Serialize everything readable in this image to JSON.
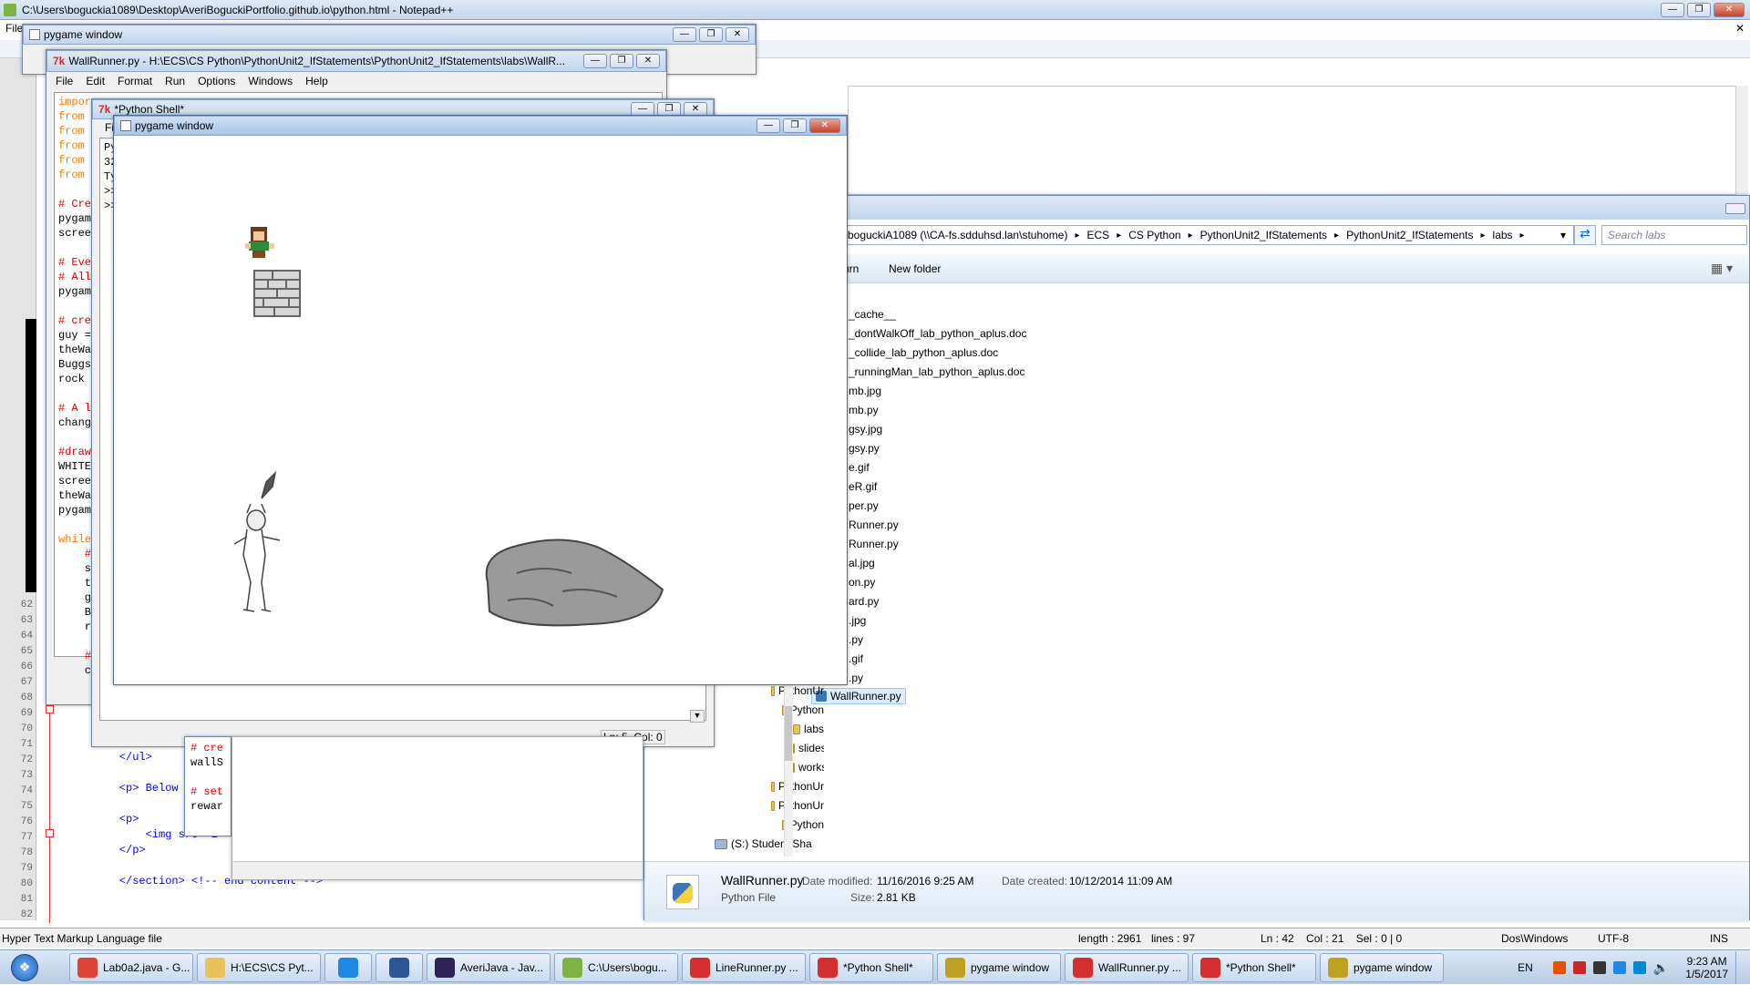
{
  "notepad": {
    "title": "C:\\Users\\boguckia1089\\Desktop\\AveriBoguckiPortfolio.github.io\\python.html - Notepad++",
    "menu_first": "File",
    "gutter_lines": [
      "62",
      "63",
      "64",
      "65",
      "66",
      "67",
      "68",
      "69",
      "70",
      "71",
      "72",
      "73",
      "74",
      "75",
      "76",
      "77",
      "78",
      "79",
      "80",
      "81",
      "82"
    ],
    "code_lines": [
      {
        "n": "72",
        "text": "        <li>"
      },
      {
        "n": "73",
        "text": "    </ul>"
      },
      {
        "n": "75",
        "text": "    <p> Below"
      },
      {
        "n": "77",
        "text": "    <p>"
      },
      {
        "n": "78",
        "text": "        <img src=\"i"
      },
      {
        "n": "79",
        "text": "    </p>"
      },
      {
        "n": "81",
        "text": "    </section> <!-- end content -->"
      }
    ],
    "status": {
      "file_type": "Hyper Text Markup Language file",
      "length": "length : 2961",
      "lines": "lines : 97",
      "position": "Ln : 42    Col : 21    Sel : 0 | 0",
      "eol": "Dos\\Windows",
      "encoding": "UTF-8",
      "mode": "INS"
    }
  },
  "pygame_back": {
    "title": "pygame window"
  },
  "wallrunner_editor": {
    "title": "WallRunner.py - H:\\ECS\\CS Python\\PythonUnit2_IfStatements\\PythonUnit2_IfStatements\\labs\\WallR...",
    "menu": [
      "File",
      "Edit",
      "Format",
      "Run",
      "Options",
      "Windows",
      "Help"
    ],
    "code": [
      {
        "text": "impor",
        "color": "#ff7700"
      },
      {
        "text": "from",
        "color": "#ff7700"
      },
      {
        "text": "from",
        "color": "#ff7700"
      },
      {
        "text": "from",
        "color": "#ff7700"
      },
      {
        "text": "from",
        "color": "#ff7700"
      },
      {
        "text": "from",
        "color": "#ff7700"
      },
      {
        "text": "",
        "color": "#000"
      },
      {
        "text": "# Cre",
        "color": "#dd0000"
      },
      {
        "text": "pygam",
        "color": "#000"
      },
      {
        "text": "scree",
        "color": "#000"
      },
      {
        "text": "",
        "color": "#000"
      },
      {
        "text": "# Eve",
        "color": "#dd0000"
      },
      {
        "text": "# All",
        "color": "#dd0000"
      },
      {
        "text": "pygam",
        "color": "#000"
      },
      {
        "text": "",
        "color": "#000"
      },
      {
        "text": "# cre",
        "color": "#dd0000"
      },
      {
        "text": "guy =",
        "color": "#000"
      },
      {
        "text": "theWa",
        "color": "#000"
      },
      {
        "text": "Buggs",
        "color": "#000"
      },
      {
        "text": "rock ",
        "color": "#000"
      },
      {
        "text": "",
        "color": "#000"
      },
      {
        "text": "# A l",
        "color": "#dd0000"
      },
      {
        "text": "chang",
        "color": "#000"
      },
      {
        "text": "",
        "color": "#000"
      },
      {
        "text": "#draw",
        "color": "#dd0000"
      },
      {
        "text": "WHITE",
        "color": "#000"
      },
      {
        "text": "scree",
        "color": "#000"
      },
      {
        "text": "theWa",
        "color": "#000"
      },
      {
        "text": "pygam",
        "color": "#000"
      },
      {
        "text": "",
        "color": "#000"
      },
      {
        "text": "while",
        "color": "#ff7700"
      },
      {
        "text": "    #",
        "color": "#dd0000"
      },
      {
        "text": "    s",
        "color": "#000"
      },
      {
        "text": "    t",
        "color": "#000"
      },
      {
        "text": "    g",
        "color": "#000"
      },
      {
        "text": "    B",
        "color": "#000"
      },
      {
        "text": "    r",
        "color": "#000"
      },
      {
        "text": "",
        "color": "#000"
      },
      {
        "text": "    #",
        "color": "#dd0000"
      },
      {
        "text": "    c",
        "color": "#000"
      }
    ]
  },
  "python_shell": {
    "title": "*Python Shell*",
    "code": [
      "Py",
      "32",
      "Ty",
      ">>",
      ">>"
    ],
    "status": "Ln: 5  Col: 0",
    "lower_code": [
      "# cre",
      "wallS",
      "",
      "# set",
      "rewar"
    ]
  },
  "pygame_front": {
    "title": "pygame window"
  },
  "explorer": {
    "breadcrumb": [
      "boguckiA1089 (\\\\CA-fs.sdduhsd.lan\\stuhome)",
      "ECS",
      "CS Python",
      "PythonUnit2_IfStatements",
      "PythonUnit2_IfStatements",
      "labs"
    ],
    "search_placeholder": "Search labs",
    "toolbar": [
      "urn",
      "New folder"
    ],
    "files": [
      "_cache__",
      "_dontWalkOff_lab_python_aplus.doc",
      "_collide_lab_python_aplus.doc",
      "_runningMan_lab_python_aplus.doc",
      "mb.jpg",
      "mb.py",
      "gsy.jpg",
      "gsy.py",
      "e.gif",
      "eR.gif",
      "per.py",
      "Runner.py",
      "Runner.py",
      "al.jpg",
      "on.py",
      "ard.py",
      ".jpg",
      ".py",
      ".gif",
      ".py"
    ],
    "selected_file": "WallRunner.py",
    "tree": [
      {
        "label": "PythonUr",
        "indent": 0
      },
      {
        "label": "Python",
        "indent": 1
      },
      {
        "label": "labs",
        "indent": 2
      },
      {
        "label": "slides",
        "indent": 2
      },
      {
        "label": "works",
        "indent": 2
      },
      {
        "label": "PythonUr",
        "indent": 0
      },
      {
        "label": "PythonUr",
        "indent": 0
      },
      {
        "label": "Python",
        "indent": 1
      },
      {
        "label": "(S:) Student Sha",
        "indent": -1
      },
      {
        "label": "Network",
        "indent": -1
      }
    ],
    "details": {
      "name": "WallRunner.py",
      "type": "Python File",
      "modified_label": "Date modified:",
      "modified": "11/16/2016 9:25 AM",
      "size_label": "Size:",
      "size": "2.81 KB",
      "created_label": "Date created:",
      "created": "10/12/2014 11:09 AM"
    }
  },
  "taskbar": {
    "items": [
      {
        "label": "Lab0a2.java - G...",
        "icon": "chrome-icon",
        "color": "#db4437"
      },
      {
        "label": "H:\\ECS\\CS Pyt...",
        "icon": "folder-icon",
        "color": "#e8c15c"
      },
      {
        "label": "",
        "icon": "ie-icon",
        "color": "#1e88e5"
      },
      {
        "label": "",
        "icon": "word-icon",
        "color": "#2b579a"
      },
      {
        "label": "AveriJava - Jav...",
        "icon": "eclipse-icon",
        "color": "#2c2255"
      },
      {
        "label": "C:\\Users\\bogu...",
        "icon": "notepadpp-icon",
        "color": "#7cb342"
      },
      {
        "label": "LineRunner.py ...",
        "icon": "idle-icon",
        "color": "#d32f2f"
      },
      {
        "label": "*Python Shell*",
        "icon": "idle-icon",
        "color": "#d32f2f"
      },
      {
        "label": "pygame window",
        "icon": "pygame-icon",
        "color": "#c0a020"
      },
      {
        "label": "WallRunner.py ...",
        "icon": "idle-icon",
        "color": "#d32f2f"
      },
      {
        "label": "*Python Shell*",
        "icon": "idle-icon",
        "color": "#d32f2f"
      },
      {
        "label": "pygame window",
        "icon": "pygame-icon",
        "color": "#c0a020"
      }
    ],
    "lang": "EN",
    "time": "9:23 AM",
    "date": "1/5/2017"
  }
}
